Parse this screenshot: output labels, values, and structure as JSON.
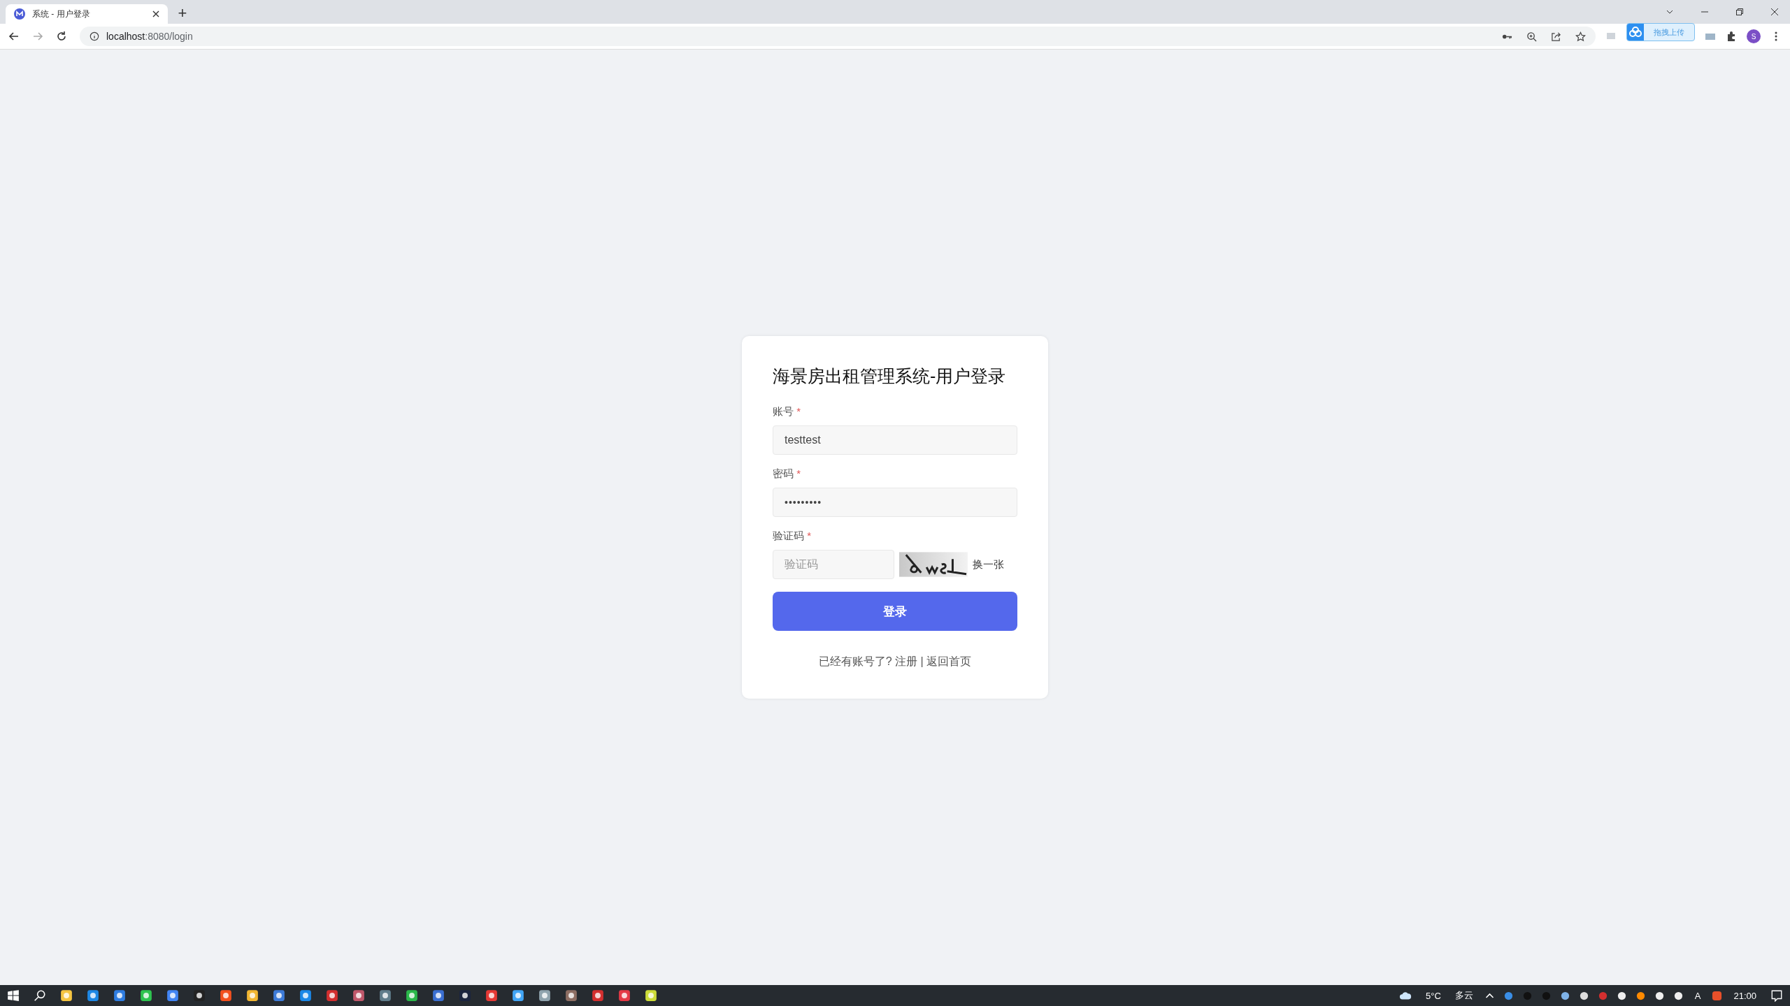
{
  "browser": {
    "tab": {
      "title": "系统 - 用户登录",
      "selected": true
    },
    "new_tab": "+",
    "address": {
      "host": "localhost",
      "path": ":8080/login"
    },
    "upload_pill": "拖拽上传",
    "profile_initial": "S"
  },
  "login": {
    "title": "海景房出租管理系统-用户登录",
    "fields": [
      {
        "kind": "text",
        "label": "账号",
        "required_mark": "*",
        "value": "testtest"
      },
      {
        "kind": "password",
        "label": "密码",
        "required_mark": "*",
        "value": "•••••••••"
      },
      {
        "kind": "captcha",
        "label": "验证码",
        "required_mark": "*",
        "placeholder": "验证码",
        "refresh": "换一张"
      }
    ],
    "submit": "登录",
    "footer": {
      "text": "已经有账号了?",
      "register": "注册",
      "separator": "|",
      "home": "返回首页"
    }
  },
  "taskbar": {
    "weather": "5°C",
    "condition": "多云",
    "ime": "A",
    "time": "21:00"
  }
}
